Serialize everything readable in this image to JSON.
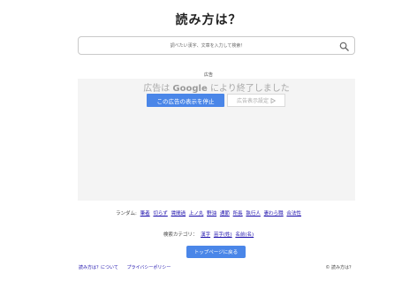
{
  "page": {
    "title": "読み方は？"
  },
  "search": {
    "placeholder": "調べたい漢字、文章を入力して検索！",
    "icon": "search-icon"
  },
  "ad": {
    "label": "広告",
    "ended_prefix": "広告は",
    "ended_brand": "Google",
    "ended_suffix": "により終了しました",
    "stop_button": "この広告の表示を停止",
    "settings_button": "広告表示設定",
    "settings_icon": "play-triangle-icon"
  },
  "random": {
    "label": "ランダム:",
    "links": [
      "筆者",
      "切らず",
      "賃間過",
      "上ノ丸",
      "野油",
      "通節",
      "所長",
      "執行人",
      "妻わら職",
      "合法性"
    ]
  },
  "categories": {
    "label": "検索カテゴリ：",
    "links": [
      "漢字",
      "苗字(姓)",
      "名前(名)"
    ]
  },
  "top_button": "トップページに戻る",
  "footer": {
    "about": "読み方は？について",
    "privacy": "プライバシーポリシー",
    "copyright": "© 読み方は？"
  },
  "colors": {
    "accent": "#4a86e8",
    "link": "#1a0dab",
    "ad_bg": "#f4f4f4"
  }
}
